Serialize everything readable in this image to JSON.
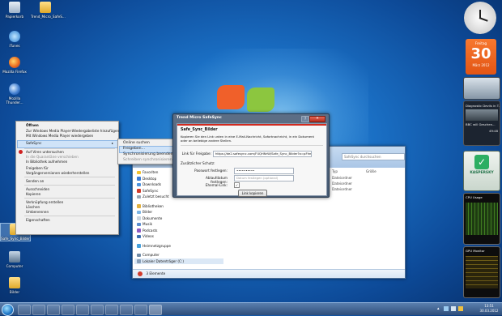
{
  "desktop": {
    "icons": [
      {
        "label": "Papierkorb"
      },
      {
        "label": "Trend_Micro_SafeS..."
      },
      {
        "label": "iTunes"
      },
      {
        "label": "Mozilla Firefox"
      },
      {
        "label": "Mozilla Thunder..."
      },
      {
        "label": "Safe_Sync_Bilder"
      },
      {
        "label": "Computer"
      },
      {
        "label": "Bilder"
      }
    ]
  },
  "gadgets": {
    "calendar": {
      "weekday": "Freitag",
      "day": "30",
      "month_year": "März 2012"
    },
    "news": {
      "headline_1": "Diagnostic Devils in T...",
      "headline_2": "BBC will Geschen...",
      "time": "49:48"
    },
    "kaspersky": {
      "label": "KASPERSKY"
    },
    "cpu": {
      "title": "CPU Usage"
    },
    "gpu": {
      "title": "GPU Monitor"
    }
  },
  "explorer": {
    "search_placeholder": "SafeSync durchsuchen",
    "columns": {
      "type": "Typ",
      "size": "Größe"
    },
    "rows": [
      {
        "type": "Dateiordner"
      },
      {
        "type": "Dateiordner"
      },
      {
        "type": "Dateiordner"
      }
    ],
    "nav": [
      {
        "label": "Favoriten"
      },
      {
        "label": "Desktop"
      },
      {
        "label": "Downloads"
      },
      {
        "label": "SafeSync"
      },
      {
        "label": "Zuletzt besucht"
      },
      {
        "label": "Bibliotheken"
      },
      {
        "label": "Bilder"
      },
      {
        "label": "Dokumente"
      },
      {
        "label": "Musik"
      },
      {
        "label": "Podcasts"
      },
      {
        "label": "Videos"
      },
      {
        "label": "Heimnetzgruppe"
      },
      {
        "label": "Computer"
      },
      {
        "label": "Lokaler Datenträger (C:)"
      }
    ],
    "status": "3 Elemente"
  },
  "context_menu": {
    "items": [
      {
        "label": "Öffnen"
      },
      {
        "label": "Zur Windows Media Player-Wiedergabeliste hinzufügen"
      },
      {
        "label": "Mit Windows Media Player wiedergeben"
      },
      {
        "label": "SafeSync"
      },
      {
        "label": "Auf Viren untersuchen"
      },
      {
        "label": "In die Quarantäne verschieben"
      },
      {
        "label": "In Bibliothek aufnehmen"
      },
      {
        "label": "Freigeben für"
      },
      {
        "label": "Vorgängerversionen wiederherstellen"
      },
      {
        "label": "Senden an"
      },
      {
        "label": "Ausschneiden"
      },
      {
        "label": "Kopieren"
      },
      {
        "label": "Verknüpfung erstellen"
      },
      {
        "label": "Löschen"
      },
      {
        "label": "Umbenennen"
      },
      {
        "label": "Eigenschaften"
      }
    ],
    "submenu": [
      {
        "label": "Online suchen"
      },
      {
        "label": "Freigeben..."
      },
      {
        "label": "Synchronisierung beenden"
      },
      {
        "label": "Schreiben synchronisieren"
      }
    ]
  },
  "dialog": {
    "title": "Trend Micro SafeSync",
    "folder": "Safe_Sync_Bilder",
    "description": "Kopieren Sie den Link unten in eine E-Mail-Nachricht, Sofortnachricht, in ein Dokument oder an beliebige andere Stellen.",
    "link_label": "Link für Freigabe:",
    "link_value": "https://de2.safesync.com/F4QHNrW/Safe_Sync_Bilder?a=pFhm...",
    "extra_protection": "Zusätzlicher Schutz:",
    "password_label": "Passwort festlegen:",
    "password_value": "••••••••••",
    "expiry_label": "Ablaufdatum festlegen:",
    "expiry_placeholder": "Datum festlegen (optional)",
    "email_link_label": "Ehemal-Link:",
    "copy_button": "Link kopieren"
  },
  "taskbar": {
    "clock_time": "13:51",
    "clock_date": "30.03.2012"
  }
}
